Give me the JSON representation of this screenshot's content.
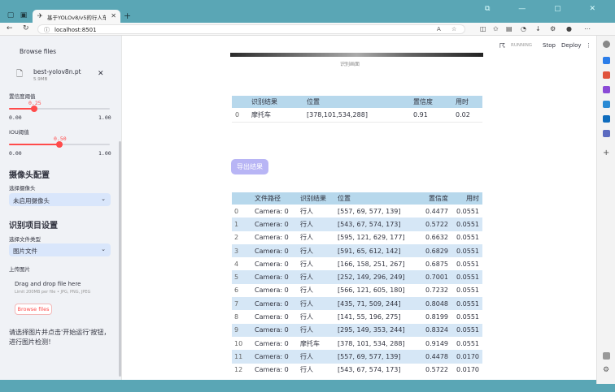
{
  "browser": {
    "tab_title": "基于YOLOv8/v5的行人车辆检测",
    "url": "localhost:8501"
  },
  "app_header": {
    "running_label": "RUNNING",
    "stop_label": "Stop",
    "deploy_label": "Deploy"
  },
  "sidebar": {
    "browse_files_top": "Browse files",
    "model_file": {
      "name": "best-yolov8n.pt",
      "size": "5.9MB"
    },
    "conf_slider": {
      "label": "置信度阈值",
      "value": "0.25",
      "min": "0.00",
      "max": "1.00",
      "fraction": 0.25
    },
    "iou_slider": {
      "label": "IOU阈值",
      "value": "0.50",
      "min": "0.00",
      "max": "1.00",
      "fraction": 0.5
    },
    "camera_section": "摄像头配置",
    "camera_select_label": "选择摄像头",
    "camera_select_value": "未启用摄像头",
    "detect_section": "识别项目设置",
    "filetype_label": "选择文件类型",
    "filetype_value": "图片文件",
    "upload_label": "上传图片",
    "dropzone_title": "Drag and drop file here",
    "dropzone_hint": "Limit 200MB per file • JPG, PNG, JPEG",
    "browse_files_btn": "Browse files",
    "instruction": "请选择图片并点击'开始运行'按钮，进行图片检测！"
  },
  "main": {
    "image_caption": "识别画面",
    "result_table": {
      "headers": [
        "",
        "识别结果",
        "位置",
        "置信度",
        "用时"
      ],
      "rows": [
        [
          "0",
          "摩托车",
          "[378,101,534,288]",
          "0.91",
          "0.02"
        ]
      ]
    },
    "export_button": "导出结果",
    "log_table": {
      "headers": [
        "",
        "文件路径",
        "识别结果",
        "位置",
        "置信度",
        "用时"
      ],
      "rows": [
        [
          "0",
          "Camera: 0",
          "行人",
          "[557, 69, 577, 139]",
          "0.4477",
          "0.0551"
        ],
        [
          "1",
          "Camera: 0",
          "行人",
          "[543, 67, 574, 173]",
          "0.5722",
          "0.0551"
        ],
        [
          "2",
          "Camera: 0",
          "行人",
          "[595, 121, 629, 177]",
          "0.6632",
          "0.0551"
        ],
        [
          "3",
          "Camera: 0",
          "行人",
          "[591, 65, 612, 142]",
          "0.6829",
          "0.0551"
        ],
        [
          "4",
          "Camera: 0",
          "行人",
          "[166, 158, 251, 267]",
          "0.6875",
          "0.0551"
        ],
        [
          "5",
          "Camera: 0",
          "行人",
          "[252, 149, 296, 249]",
          "0.7001",
          "0.0551"
        ],
        [
          "6",
          "Camera: 0",
          "行人",
          "[566, 121, 605, 180]",
          "0.7232",
          "0.0551"
        ],
        [
          "7",
          "Camera: 0",
          "行人",
          "[435, 71, 509, 244]",
          "0.8048",
          "0.0551"
        ],
        [
          "8",
          "Camera: 0",
          "行人",
          "[141, 55, 196, 275]",
          "0.8199",
          "0.0551"
        ],
        [
          "9",
          "Camera: 0",
          "行人",
          "[295, 149, 353, 244]",
          "0.8324",
          "0.0551"
        ],
        [
          "10",
          "Camera: 0",
          "摩托车",
          "[378, 101, 534, 288]",
          "0.9149",
          "0.0551"
        ],
        [
          "11",
          "Camera: 0",
          "行人",
          "[557, 69, 577, 139]",
          "0.4478",
          "0.0170"
        ],
        [
          "12",
          "Camera: 0",
          "行人",
          "[543, 67, 574, 173]",
          "0.5722",
          "0.0170"
        ]
      ]
    }
  }
}
